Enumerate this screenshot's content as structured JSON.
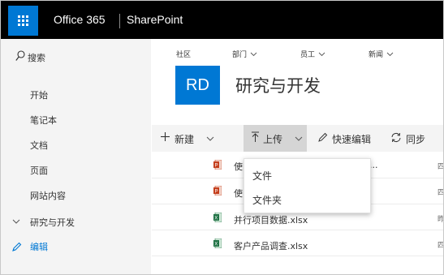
{
  "suite_bar": {
    "app_launcher_icon": "waffle-icon",
    "product_name": "Office 365",
    "app_name": "SharePoint",
    "colors": {
      "bar": "#000000",
      "launcher": "#0078d4"
    }
  },
  "left_nav": {
    "search_label": "搜索",
    "items": [
      {
        "label": "开始"
      },
      {
        "label": "笔记本"
      },
      {
        "label": "文档"
      },
      {
        "label": "页面"
      },
      {
        "label": "网站内容"
      },
      {
        "label": "研究与开发",
        "icon": "chevron-down-icon"
      }
    ],
    "edit_label": "编辑"
  },
  "site_header": {
    "top_nav": [
      {
        "label": "社区"
      },
      {
        "label": "部门"
      },
      {
        "label": "员工"
      },
      {
        "label": "新闻"
      }
    ],
    "logo_text": "RD",
    "site_title": "研究与开发",
    "accent_color": "#0078d4"
  },
  "command_bar": {
    "new_label": "新建",
    "upload_label": "上传",
    "quick_edit_label": "快速编辑",
    "sync_label": "同步"
  },
  "upload_menu": {
    "items": [
      {
        "label": "文件"
      },
      {
        "label": "文件夹"
      }
    ]
  },
  "files": [
    {
      "name": "使",
      "name_tail": "...",
      "type": "pptx",
      "modified": "四"
    },
    {
      "name": "使",
      "type": "pptx",
      "modified": "四"
    },
    {
      "name": "并行项目数据.xlsx",
      "type": "xlsx",
      "modified": "昨"
    },
    {
      "name": "客户产品调查.xlsx",
      "type": "xlsx",
      "modified": "四"
    }
  ]
}
